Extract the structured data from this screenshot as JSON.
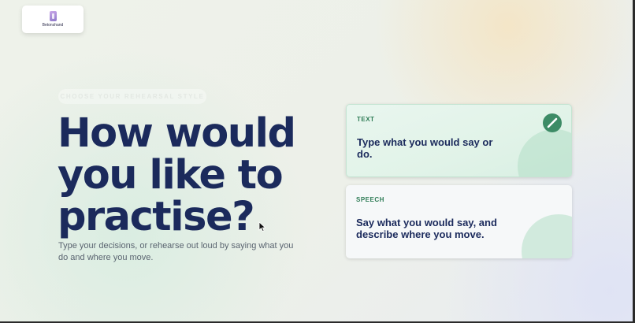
{
  "brand": {
    "logo_text": "Betonshand"
  },
  "eyebrow": "CHOOSE YOUR REHEARSAL STYLE",
  "headline": "How would you like to practise?",
  "subtext": "Type your decisions, or rehearse out loud by saying what you do and where you move.",
  "options": [
    {
      "tag": "TEXT",
      "description": "Type what you would say or do.",
      "icon": "pencil-icon",
      "selected": true
    },
    {
      "tag": "SPEECH",
      "description": "Say what you would say, and describe where you move.",
      "icon": "",
      "selected": false
    }
  ],
  "colors": {
    "headline": "#1b2a5c",
    "accent_green": "#3d8b66",
    "tag_green": "#2f7c56",
    "selected_card_bg": "#e1f3e8"
  }
}
